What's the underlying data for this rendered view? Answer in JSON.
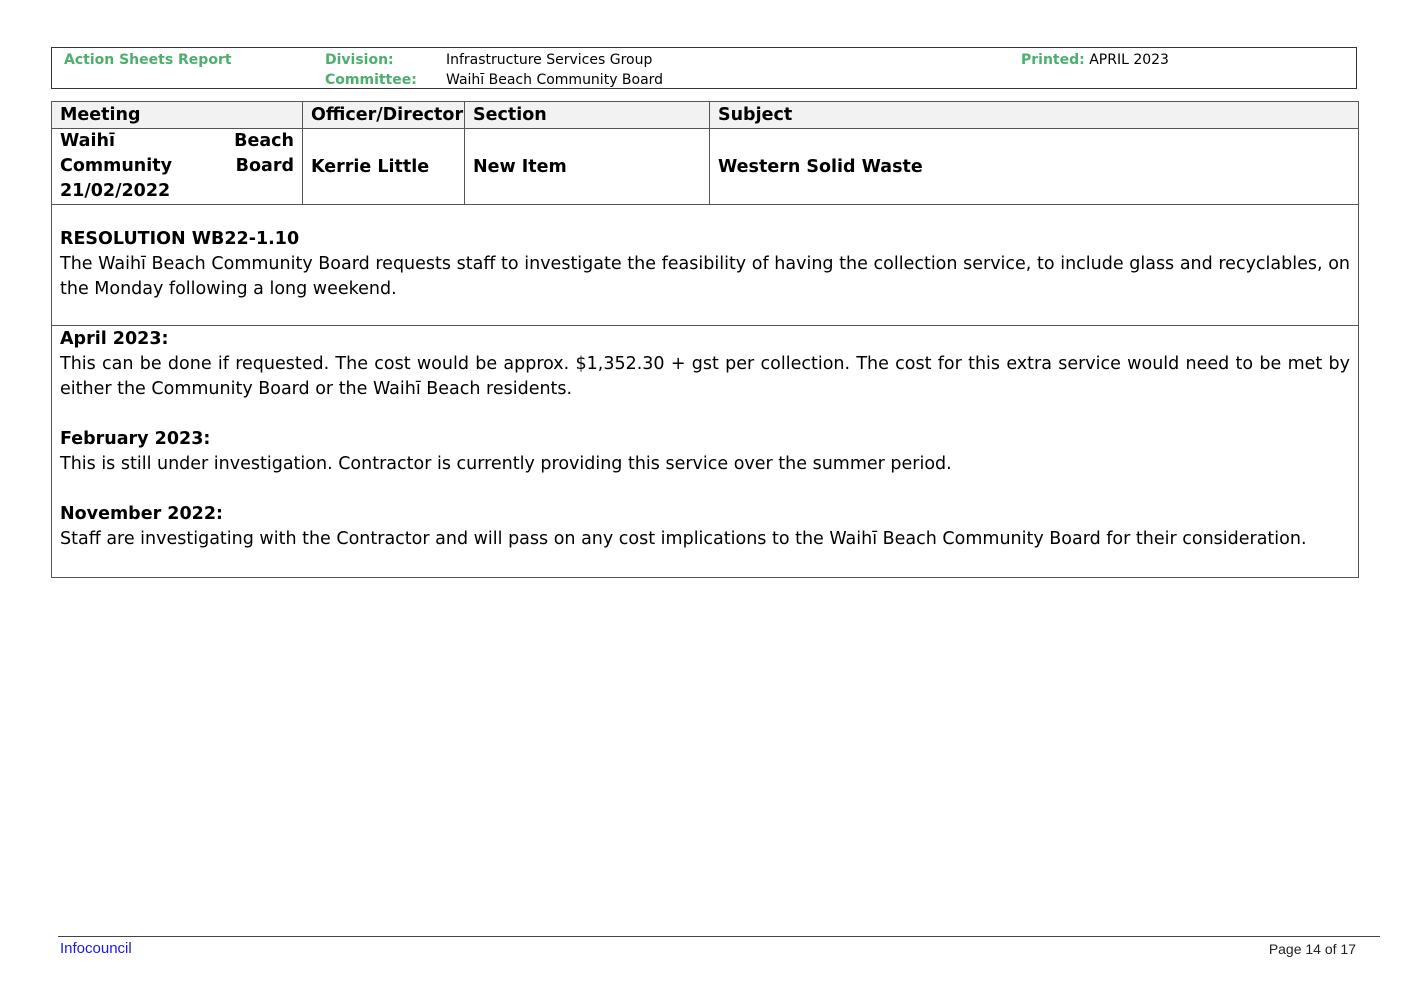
{
  "header": {
    "report_title": "Action Sheets Report",
    "division_label": "Division:",
    "division_value": "Infrastructure Services Group",
    "committee_label": "Committee:",
    "committee_value": "Waihī Beach Community Board",
    "printed_label": "Printed:",
    "printed_value": "APRIL 2023"
  },
  "table": {
    "columns": [
      "Meeting",
      "Officer/Director",
      "Section",
      "Subject"
    ],
    "row": {
      "meeting": "Waihī Beach Community Board 21/02/2022",
      "officer": "Kerrie Little",
      "section": "New Item",
      "subject": "Western Solid Waste"
    },
    "resolution": {
      "title": "RESOLUTION WB22-1.10",
      "text": "The Waihī Beach Community Board requests staff to investigate the feasibility of having the collection service, to include glass and recyclables, on the Monday following a long weekend."
    },
    "updates": [
      {
        "title": "April 2023:",
        "text": "This can be done if requested.  The cost would be approx. $1,352.30 + gst per collection.  The cost for this extra service would need to be met by either the Community Board or the Waihī Beach residents."
      },
      {
        "title": "February 2023:",
        "text": "This is still under investigation.  Contractor is currently providing this service over the summer period."
      },
      {
        "title": "November 2022:",
        "text": "Staff are investigating with the Contractor and will pass on any cost implications to the Waihī Beach Community Board for their consideration."
      }
    ]
  },
  "footer": {
    "left": "Infocouncil",
    "right": "Page 14 of 17"
  }
}
